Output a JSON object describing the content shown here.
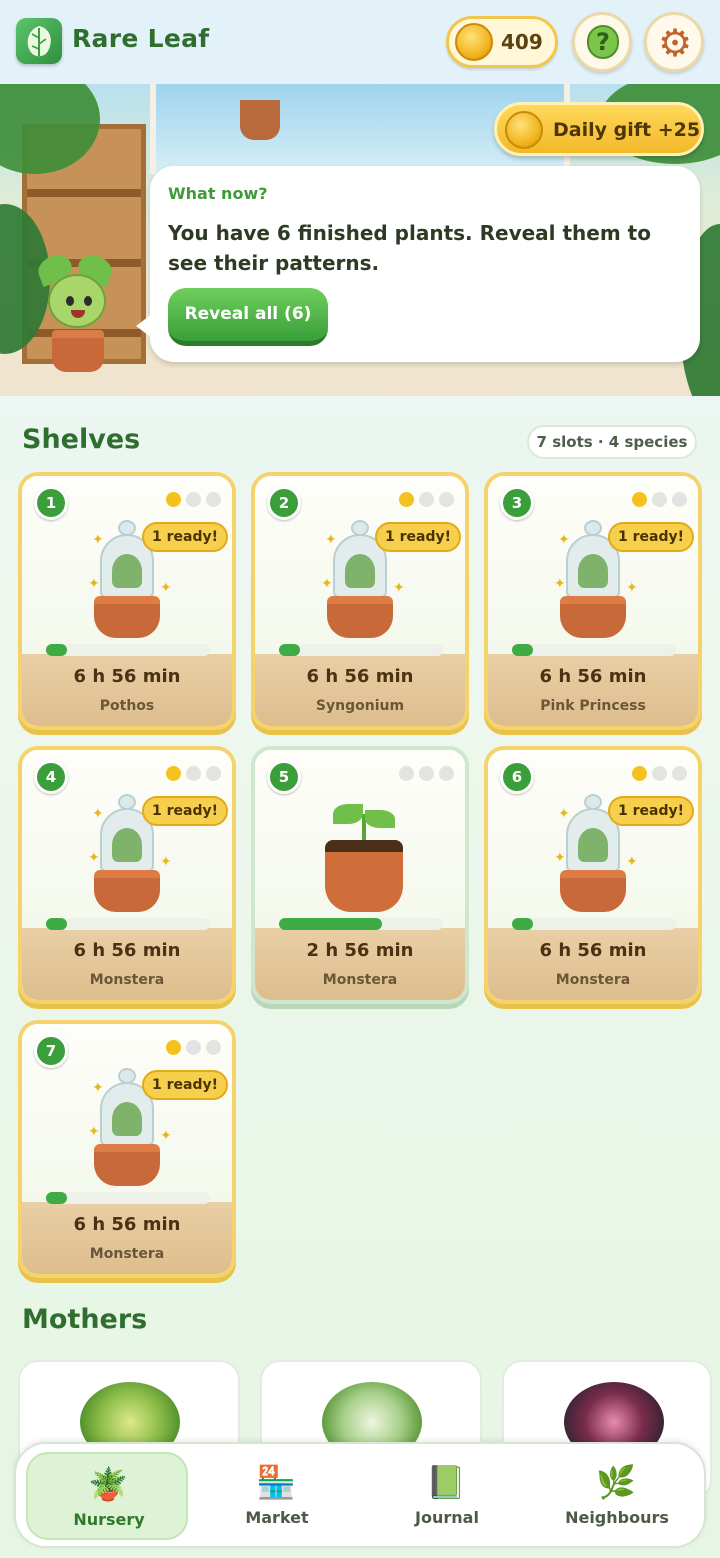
{
  "header": {
    "app_title": "Rare Leaf",
    "coins": "409",
    "icons": [
      "leaf-logo-icon",
      "coin-icon",
      "help-icon",
      "gear-icon"
    ]
  },
  "hero": {
    "daily_gift_label": "Daily gift +25",
    "prompt_heading": "What now?",
    "prompt_body": "You have 6 finished plants. Reveal them to see their patterns.",
    "reveal_button": "Reveal all (6)"
  },
  "shelves": {
    "title": "Shelves",
    "summary": "7 slots · 4 species",
    "cards": [
      {
        "number": "1",
        "ready": "1 ready!",
        "time": "6 h 56 min",
        "species": "Pothos",
        "progress": 0.13,
        "dots_filled": 1,
        "state": "ready"
      },
      {
        "number": "2",
        "ready": "1 ready!",
        "time": "6 h 56 min",
        "species": "Syngonium",
        "progress": 0.13,
        "dots_filled": 1,
        "state": "ready"
      },
      {
        "number": "3",
        "ready": "1 ready!",
        "time": "6 h 56 min",
        "species": "Pink Princess",
        "progress": 0.13,
        "dots_filled": 1,
        "state": "ready"
      },
      {
        "number": "4",
        "ready": "1 ready!",
        "time": "6 h 56 min",
        "species": "Monstera",
        "progress": 0.13,
        "dots_filled": 1,
        "state": "ready"
      },
      {
        "number": "5",
        "ready": "",
        "time": "2 h 56 min",
        "species": "Monstera",
        "progress": 0.63,
        "dots_filled": 0,
        "state": "growing"
      },
      {
        "number": "6",
        "ready": "1 ready!",
        "time": "6 h 56 min",
        "species": "Monstera",
        "progress": 0.13,
        "dots_filled": 1,
        "state": "ready"
      },
      {
        "number": "7",
        "ready": "1 ready!",
        "time": "6 h 56 min",
        "species": "Monstera",
        "progress": 0.13,
        "dots_filled": 1,
        "state": "ready"
      }
    ]
  },
  "mothers": {
    "title": "Mothers"
  },
  "nav": {
    "items": [
      {
        "label": "Nursery",
        "icon": "potted-plant-icon",
        "active": true
      },
      {
        "label": "Market",
        "icon": "market-stall-icon",
        "active": false
      },
      {
        "label": "Journal",
        "icon": "journal-book-icon",
        "active": false
      },
      {
        "label": "Neighbours",
        "icon": "neighbours-plants-icon",
        "active": false
      }
    ]
  },
  "colors": {
    "brand_green": "#2f6e2e",
    "accent_gold": "#f4c21e",
    "progress_green": "#3fab45"
  }
}
